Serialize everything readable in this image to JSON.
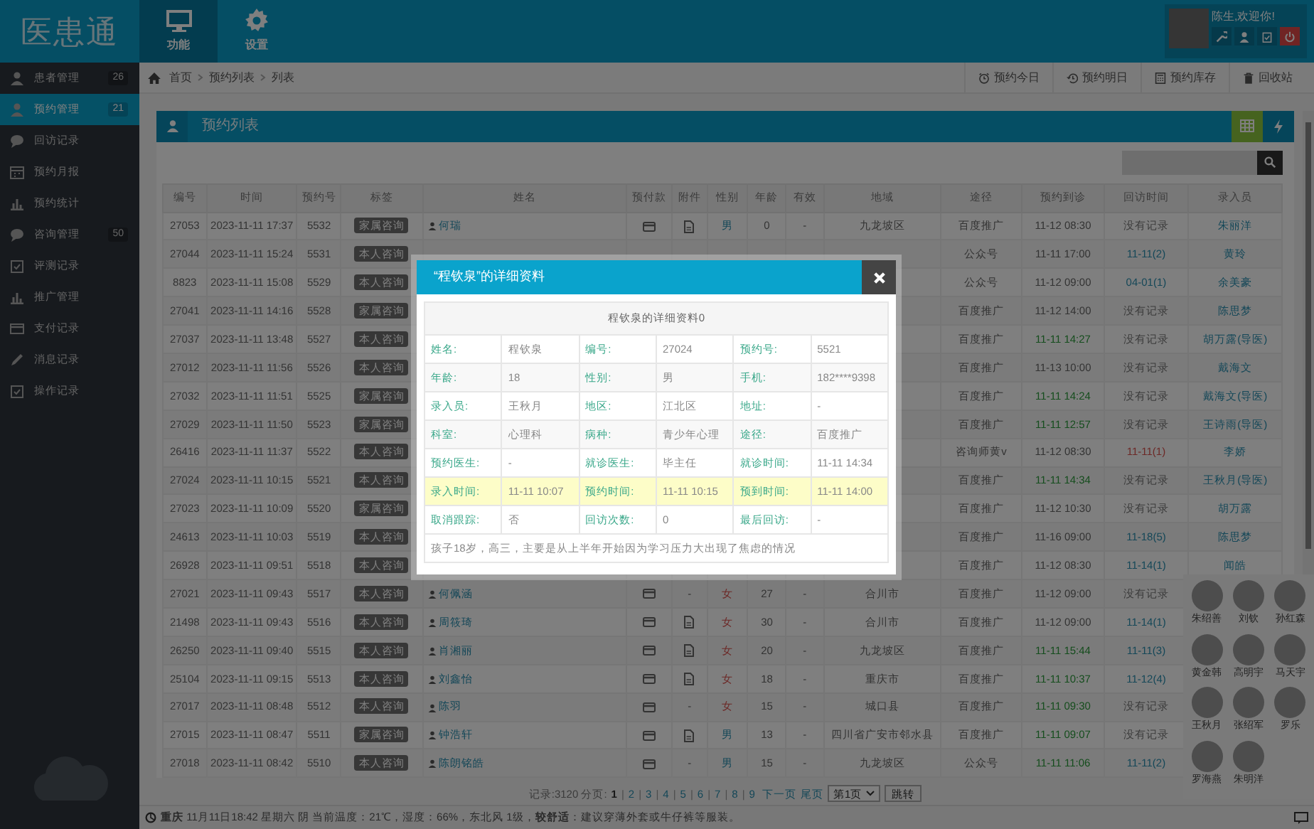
{
  "header": {
    "logo": "医患通",
    "nav": [
      {
        "label": "功能",
        "kind": "monitor",
        "selected": true
      },
      {
        "label": "设置",
        "kind": "gear",
        "selected": false
      }
    ],
    "user": {
      "greeting": "陈生,欢迎你!"
    }
  },
  "sidebar": {
    "items": [
      {
        "label": "患者管理",
        "kind": "user",
        "badge": "26",
        "selected": false
      },
      {
        "label": "预约管理",
        "kind": "user",
        "badge": "21",
        "selected": true
      },
      {
        "label": "回访记录",
        "kind": "chat",
        "selected": false
      },
      {
        "label": "预约月报",
        "kind": "calendar",
        "selected": false
      },
      {
        "label": "预约统计",
        "kind": "chart",
        "selected": false
      },
      {
        "label": "咨询管理",
        "kind": "chat",
        "badge": "50",
        "selected": false
      },
      {
        "label": "评测记录",
        "kind": "clipboard",
        "selected": false
      },
      {
        "label": "推广管理",
        "kind": "chart",
        "selected": false
      },
      {
        "label": "支付记录",
        "kind": "card",
        "selected": false
      },
      {
        "label": "消息记录",
        "kind": "pencil",
        "selected": false
      },
      {
        "label": "操作记录",
        "kind": "clipboard",
        "selected": false
      }
    ]
  },
  "breadcrumb": [
    "首页",
    "预约列表",
    "列表"
  ],
  "toolbar": [
    {
      "label": "预约今日",
      "kind": "alarm"
    },
    {
      "label": "预约明日",
      "kind": "history"
    },
    {
      "label": "预约库存",
      "kind": "calculator"
    },
    {
      "label": "回收站",
      "kind": "trash"
    }
  ],
  "panel": {
    "title": "预约列表"
  },
  "table": {
    "columns": [
      "编号",
      "时间",
      "预约号",
      "标签",
      "姓名",
      "预付款",
      "附件",
      "性别",
      "年龄",
      "有效",
      "地域",
      "途径",
      "预约到诊",
      "回访时间",
      "录入员"
    ],
    "rows": [
      {
        "id": "27053",
        "time": "2023-11-11 17:37",
        "no": "5532",
        "tag": "家属咨询",
        "name": "何瑞",
        "prepaid": true,
        "attachment": true,
        "gender": {
          "text": "男",
          "kind": "male"
        },
        "age": "0",
        "valid": "-",
        "region": "九龙坡区",
        "channel": "百度推广",
        "visit": "11-12 08:30",
        "visit_arrived": false,
        "followup": {
          "text": "没有记录",
          "kind": "none"
        },
        "staff": "朱丽洋"
      },
      {
        "id": "27044",
        "time": "2023-11-11 15:24",
        "no": "5531",
        "tag": "本人咨询",
        "channel": "公众号",
        "visit": "11-11 17:00",
        "visit_arrived": false,
        "followup": {
          "text": "11-11(2)",
          "kind": "done"
        },
        "staff": "黄玲"
      },
      {
        "id": "8823",
        "time": "2023-11-11 15:08",
        "no": "5529",
        "tag": "本人咨询",
        "channel": "公众号",
        "visit": "11-12 09:00",
        "visit_arrived": false,
        "followup": {
          "text": "04-01(1)",
          "kind": "done"
        },
        "staff": "余美豪"
      },
      {
        "id": "27041",
        "time": "2023-11-11 14:16",
        "no": "5528",
        "tag": "家属咨询",
        "channel": "百度推广",
        "visit": "11-12 14:00",
        "visit_arrived": false,
        "followup": {
          "text": "没有记录",
          "kind": "none"
        },
        "staff": "陈思梦"
      },
      {
        "id": "27037",
        "time": "2023-11-11 13:48",
        "no": "5527",
        "tag": "本人咨询",
        "channel": "百度推广",
        "visit": "11-11 14:27",
        "visit_arrived": true,
        "followup": {
          "text": "没有记录",
          "kind": "none"
        },
        "staff": "胡万露(导医)"
      },
      {
        "id": "27012",
        "time": "2023-11-11 11:56",
        "no": "5526",
        "tag": "本人咨询",
        "channel": "百度推广",
        "visit": "11-13 10:00",
        "visit_arrived": false,
        "followup": {
          "text": "没有记录",
          "kind": "none"
        },
        "staff": "戴海文"
      },
      {
        "id": "27032",
        "time": "2023-11-11 11:51",
        "no": "5525",
        "tag": "家属咨询",
        "channel": "百度推广",
        "visit": "11-11 14:24",
        "visit_arrived": true,
        "followup": {
          "text": "没有记录",
          "kind": "none"
        },
        "staff": "戴海文(导医)"
      },
      {
        "id": "27029",
        "time": "2023-11-11 11:50",
        "no": "5523",
        "tag": "家属咨询",
        "channel": "百度推广",
        "visit": "11-11 12:57",
        "visit_arrived": true,
        "followup": {
          "text": "没有记录",
          "kind": "none"
        },
        "staff": "王诗雨(导医)"
      },
      {
        "id": "26416",
        "time": "2023-11-11 11:37",
        "no": "5522",
        "tag": "本人咨询",
        "channel": "咨询师黄v",
        "visit": "11-12 08:30",
        "visit_arrived": false,
        "followup": {
          "text": "11-11(1)",
          "kind": "overdue"
        },
        "staff": "李娇"
      },
      {
        "id": "27024",
        "time": "2023-11-11 10:15",
        "no": "5521",
        "tag": "本人咨询",
        "channel": "百度推广",
        "visit": "11-11 14:34",
        "visit_arrived": true,
        "followup": {
          "text": "没有记录",
          "kind": "none"
        },
        "staff": "王秋月(导医)"
      },
      {
        "id": "27023",
        "time": "2023-11-11 10:09",
        "no": "5520",
        "tag": "家属咨询",
        "channel": "百度推广",
        "visit": "11-12 10:30",
        "visit_arrived": false,
        "followup": {
          "text": "没有记录",
          "kind": "none"
        },
        "staff": "胡万露"
      },
      {
        "id": "24613",
        "time": "2023-11-11 10:03",
        "no": "5519",
        "tag": "本人咨询",
        "channel": "百度推广",
        "visit": "11-16 09:00",
        "visit_arrived": false,
        "followup": {
          "text": "11-18(5)",
          "kind": "done"
        },
        "staff": "陈思梦"
      },
      {
        "id": "26928",
        "time": "2023-11-11 09:51",
        "no": "5518",
        "tag": "本人咨询",
        "channel": "百度推广",
        "visit": "11-12 08:30",
        "visit_arrived": false,
        "followup": {
          "text": "11-14(1)",
          "kind": "done"
        },
        "staff": "闻皓"
      },
      {
        "id": "27021",
        "time": "2023-11-11 09:43",
        "no": "5517",
        "tag": "本人咨询",
        "name": "何佩涵",
        "prepaid": true,
        "attachment": false,
        "attachment_text": "-",
        "gender": {
          "text": "女",
          "kind": "female"
        },
        "age": "27",
        "valid": "-",
        "region": "合川市",
        "channel": "百度推广",
        "visit": "11-12 09:00",
        "visit_arrived": false,
        "followup": {
          "text": "没有记录",
          "kind": "none"
        }
      },
      {
        "id": "21498",
        "time": "2023-11-11 09:43",
        "no": "5516",
        "tag": "本人咨询",
        "name": "周筱琦",
        "prepaid": true,
        "attachment": true,
        "gender": {
          "text": "女",
          "kind": "female"
        },
        "age": "30",
        "valid": "-",
        "region": "合川市",
        "channel": "百度推广",
        "visit": "11-12 09:00",
        "visit_arrived": false,
        "followup": {
          "text": "11-14(1)",
          "kind": "done"
        }
      },
      {
        "id": "26250",
        "time": "2023-11-11 09:40",
        "no": "5515",
        "tag": "本人咨询",
        "name": "肖湘丽",
        "prepaid": true,
        "attachment": true,
        "gender": {
          "text": "女",
          "kind": "female"
        },
        "age": "20",
        "valid": "-",
        "region": "九龙坡区",
        "channel": "百度推广",
        "visit": "11-11 15:44",
        "visit_arrived": true,
        "followup": {
          "text": "11-11(3)",
          "kind": "done"
        }
      },
      {
        "id": "25104",
        "time": "2023-11-11 09:15",
        "no": "5513",
        "tag": "本人咨询",
        "name": "刘鑫怡",
        "prepaid": true,
        "attachment": true,
        "gender": {
          "text": "女",
          "kind": "female"
        },
        "age": "18",
        "valid": "-",
        "region": "重庆市",
        "channel": "百度推广",
        "visit": "11-11 10:37",
        "visit_arrived": true,
        "followup": {
          "text": "11-12(4)",
          "kind": "done"
        }
      },
      {
        "id": "27017",
        "time": "2023-11-11 08:48",
        "no": "5512",
        "tag": "本人咨询",
        "name": "陈羽",
        "prepaid": true,
        "attachment": false,
        "attachment_text": "-",
        "gender": {
          "text": "女",
          "kind": "female"
        },
        "age": "15",
        "valid": "-",
        "region": "城口县",
        "channel": "百度推广",
        "visit": "11-11 09:30",
        "visit_arrived": true,
        "followup": {
          "text": "没有记录",
          "kind": "none"
        }
      },
      {
        "id": "27015",
        "time": "2023-11-11 08:47",
        "no": "5511",
        "tag": "家属咨询",
        "name": "钟浩轩",
        "prepaid": true,
        "attachment": true,
        "gender": {
          "text": "男",
          "kind": "male"
        },
        "age": "13",
        "valid": "-",
        "region": "四川省广安市邻水县",
        "channel": "百度推广",
        "visit": "11-11 09:07",
        "visit_arrived": true,
        "followup": {
          "text": "没有记录",
          "kind": "none"
        }
      },
      {
        "id": "27018",
        "time": "2023-11-11 08:42",
        "no": "5510",
        "tag": "本人咨询",
        "name": "陈朗铭皓",
        "prepaid": true,
        "attachment": false,
        "attachment_text": "-",
        "gender": {
          "text": "男",
          "kind": "male"
        },
        "age": "15",
        "valid": "-",
        "region": "九龙坡区",
        "channel": "公众号",
        "visit": "11-11 11:06",
        "visit_arrived": true,
        "followup": {
          "text": "11-11(2)",
          "kind": "done"
        }
      }
    ]
  },
  "pagination": {
    "summary": "记录:3120 分页:",
    "separator": "|",
    "pages": [
      {
        "label": "1",
        "selected": true
      },
      {
        "label": "2",
        "selected": false
      },
      {
        "label": "3",
        "selected": false
      },
      {
        "label": "4",
        "selected": false
      },
      {
        "label": "5",
        "selected": false
      },
      {
        "label": "6",
        "selected": false
      },
      {
        "label": "7",
        "selected": false
      },
      {
        "label": "8",
        "selected": false
      },
      {
        "label": "9",
        "selected": false
      }
    ],
    "next": "下一页",
    "last": "尾页",
    "page_select": "第1页",
    "jump": "跳转"
  },
  "online_users": [
    "朱绍善",
    "刘钦",
    "孙红森",
    "黄金韩",
    "高明宇",
    "马天宇",
    "王秋月",
    "张绍军",
    "罗乐",
    "罗海燕",
    "朱明洋"
  ],
  "status_bar": {
    "weather": "**重庆** 11月11日18:42 星期六 阴 当前温度：21℃，湿度：66%，东北风 1级，**较舒适**：建议穿薄外套或牛仔裤等服装。"
  },
  "modal": {
    "title": "“程钦泉”的详细资料",
    "heading": "程钦泉的详细资料0",
    "rows": [
      {
        "highlighted": false,
        "cells": [
          {
            "label": "姓名:",
            "value": "程钦泉"
          },
          {
            "label": "编号:",
            "value": "27024"
          },
          {
            "label": "预约号:",
            "value": "5521"
          }
        ]
      },
      {
        "highlighted": false,
        "cells": [
          {
            "label": "年龄:",
            "value": "18"
          },
          {
            "label": "性别:",
            "value": "男"
          },
          {
            "label": "手机:",
            "value": "182****9398"
          }
        ]
      },
      {
        "highlighted": false,
        "cells": [
          {
            "label": "录入员:",
            "value": "王秋月"
          },
          {
            "label": "地区:",
            "value": "江北区"
          },
          {
            "label": "地址:",
            "value": "-"
          }
        ]
      },
      {
        "highlighted": false,
        "cells": [
          {
            "label": "科室:",
            "value": "心理科"
          },
          {
            "label": "病种:",
            "value": "青少年心理"
          },
          {
            "label": "途径:",
            "value": "百度推广"
          }
        ]
      },
      {
        "highlighted": false,
        "cells": [
          {
            "label": "预约医生:",
            "value": "-"
          },
          {
            "label": "就诊医生:",
            "value": "毕主任"
          },
          {
            "label": "就诊时间:",
            "value": "11-11 14:34"
          }
        ]
      },
      {
        "highlighted": true,
        "cells": [
          {
            "label": "录入时间:",
            "value": "11-11 10:07"
          },
          {
            "label": "预约时间:",
            "value": "11-11 10:15"
          },
          {
            "label": "预到时间:",
            "value": "11-11 14:00"
          }
        ]
      },
      {
        "highlighted": false,
        "cells": [
          {
            "label": "取消跟踪:",
            "value": "否"
          },
          {
            "label": "回访次数:",
            "value": "0"
          },
          {
            "label": "最后回访:",
            "value": "-"
          }
        ]
      }
    ],
    "note": "孩子18岁，高三，主要是从上半年开始因为学习压力大出现了焦虑的情况"
  }
}
